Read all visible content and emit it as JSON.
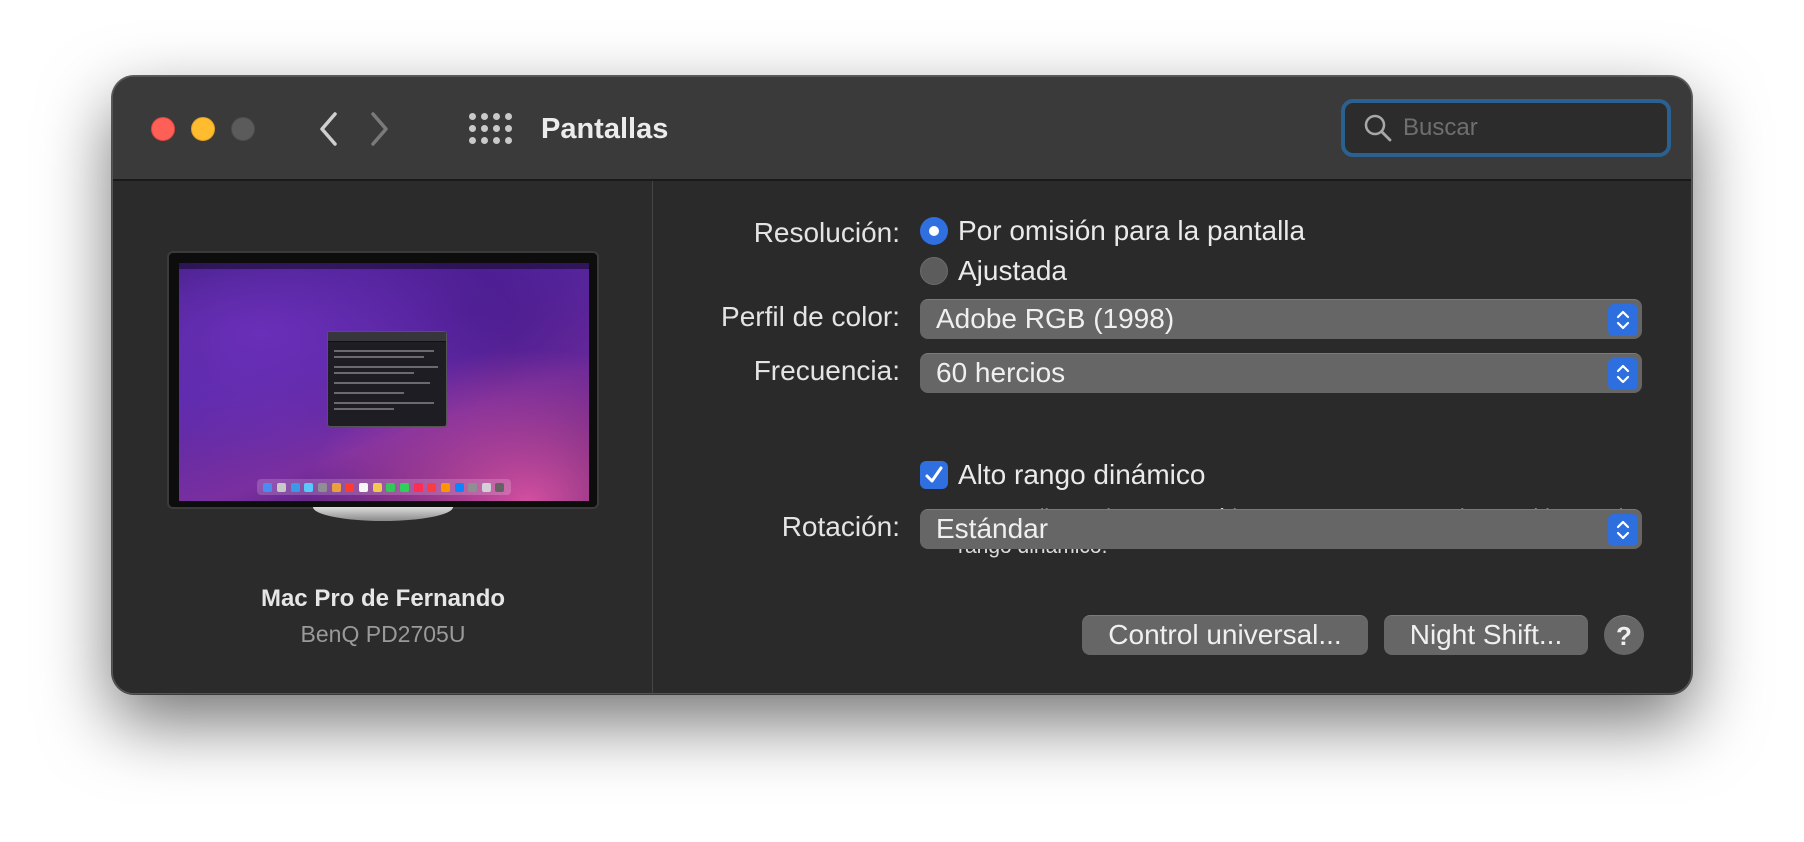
{
  "window": {
    "title": "Pantallas",
    "search": {
      "placeholder": "Buscar",
      "value": ""
    }
  },
  "device": {
    "name": "Mac Pro de Fernando",
    "model": "BenQ PD2705U"
  },
  "settings": {
    "resolution": {
      "label": "Resolución:",
      "options": [
        {
          "label": "Por omisión para la pantalla",
          "selected": true
        },
        {
          "label": "Ajustada",
          "selected": false
        }
      ]
    },
    "color_profile": {
      "label": "Perfil de color:",
      "value": "Adobe RGB (1998)"
    },
    "frequency": {
      "label": "Frecuencia:",
      "value": "60 hercios"
    },
    "hdr": {
      "label": "Alto rango dinámico",
      "checked": true,
      "hint": "La pantalla se ajusta automáticamente para mostrar el contenido con alto rango dinámico."
    },
    "rotation": {
      "label": "Rotación:",
      "value": "Estándar"
    }
  },
  "buttons": {
    "universal_control": "Control universal...",
    "night_shift": "Night Shift...",
    "help": "?"
  },
  "colors": {
    "accent": "#2f6fe0",
    "close": "#fe5f57",
    "minimize": "#febc2e",
    "search_focus_ring": "#2a6191"
  },
  "icons": [
    "back-arrow-icon",
    "forward-arrow-icon",
    "grid-icon",
    "search-icon",
    "checkmark-icon",
    "popup-arrows-icon"
  ]
}
